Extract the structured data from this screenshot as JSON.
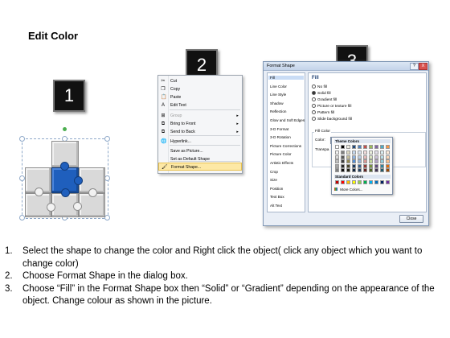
{
  "title": "Edit Color",
  "steps": [
    "1",
    "2",
    "3"
  ],
  "context_menu": {
    "items": [
      {
        "label": "Cut",
        "icon": "cut-icon",
        "glyph": "✂",
        "disabled": false,
        "arrow": ""
      },
      {
        "label": "Copy",
        "icon": "copy-icon",
        "glyph": "❐",
        "disabled": false,
        "arrow": ""
      },
      {
        "label": "Paste",
        "icon": "paste-icon",
        "glyph": "📋",
        "disabled": false,
        "arrow": ""
      },
      {
        "label": "Edit Text",
        "icon": "edit-text-icon",
        "glyph": "A",
        "disabled": false,
        "arrow": ""
      },
      {
        "label": "Group",
        "icon": "group-icon",
        "glyph": "⊞",
        "disabled": true,
        "arrow": "▸"
      },
      {
        "label": "Bring to Front",
        "icon": "bring-front-icon",
        "glyph": "⧉",
        "disabled": false,
        "arrow": "▸"
      },
      {
        "label": "Send to Back",
        "icon": "send-back-icon",
        "glyph": "⧉",
        "disabled": false,
        "arrow": "▸"
      },
      {
        "label": "Hyperlink...",
        "icon": "hyperlink-icon",
        "glyph": "🌐",
        "disabled": false,
        "arrow": ""
      },
      {
        "label": "Save as Picture...",
        "icon": "",
        "glyph": "",
        "disabled": false,
        "arrow": ""
      },
      {
        "label": "Set as Default Shape",
        "icon": "",
        "glyph": "",
        "disabled": false,
        "arrow": ""
      },
      {
        "label": "Size and Position...",
        "icon": "size-position-icon",
        "glyph": "⊡",
        "disabled": false,
        "arrow": ""
      },
      {
        "label": "Format Shape...",
        "icon": "format-shape-icon",
        "glyph": "🖌",
        "disabled": false,
        "arrow": ""
      }
    ]
  },
  "dialog": {
    "title": "Format Shape",
    "help_button": "?",
    "close_x": "X",
    "nav": [
      "Fill",
      "Line Color",
      "Line Style",
      "Shadow",
      "Reflection",
      "Glow and Soft Edges",
      "3-D Format",
      "3-D Rotation",
      "Picture Corrections",
      "Picture Color",
      "Artistic Effects",
      "Crop",
      "Size",
      "Position",
      "Text Box",
      "Alt Text"
    ],
    "pane": {
      "heading": "Fill",
      "options": [
        "No fill",
        "Solid fill",
        "Gradient fill",
        "Picture or texture fill",
        "Pattern fill",
        "Slide background fill"
      ],
      "selected_option": 1,
      "fill_color_group": "Fill Color",
      "color_label": "Color:",
      "transparency_label": "Transpa"
    },
    "close_button": "Close"
  },
  "color_popup": {
    "theme_label": "Theme Colors",
    "standard_label": "Standard Colors",
    "more_label": "More Colors...",
    "theme_top": [
      "#ffffff",
      "#000000",
      "#eeece1",
      "#1f497d",
      "#4f81bd",
      "#c0504d",
      "#9bbb59",
      "#8064a2",
      "#4bacc6",
      "#f79646"
    ],
    "theme_shades": [
      [
        "#f2f2f2",
        "#7f7f7f",
        "#ddd9c3",
        "#c6d9f0",
        "#dbe5f1",
        "#f2dcdb",
        "#ebf1dd",
        "#e5e0ec",
        "#dbeef3",
        "#fdeada"
      ],
      [
        "#d8d8d8",
        "#595959",
        "#c4bd97",
        "#8db3e2",
        "#b8cce4",
        "#e5b9b7",
        "#d7e3bc",
        "#ccc1d9",
        "#b7dde8",
        "#fbd5b5"
      ],
      [
        "#bfbfbf",
        "#3f3f3f",
        "#938953",
        "#548dd4",
        "#95b3d7",
        "#d99694",
        "#c3d69b",
        "#b2a2c7",
        "#92cddc",
        "#fac08f"
      ],
      [
        "#a5a5a5",
        "#262626",
        "#494429",
        "#17365d",
        "#366092",
        "#953734",
        "#76923c",
        "#5f497a",
        "#31859b",
        "#e36c09"
      ],
      [
        "#7f7f7f",
        "#0c0c0c",
        "#1d1b10",
        "#0f243e",
        "#244061",
        "#632423",
        "#4f6128",
        "#3f3151",
        "#205867",
        "#974806"
      ]
    ],
    "standard": [
      "#c00000",
      "#ff0000",
      "#ffc000",
      "#ffff00",
      "#92d050",
      "#00b050",
      "#00b0f0",
      "#0070c0",
      "#002060",
      "#7030a0"
    ]
  },
  "instructions": [
    {
      "num": "1.",
      "text": "Select the shape to change the color and Right click the object( click any object which you want to change color)"
    },
    {
      "num": "2.",
      "text": "Choose Format Shape in the dialog box."
    },
    {
      "num": "3.",
      "text": "Choose “Fill” in the Format Shape box then “Solid” or “Gradient” depending on the appearance of the object. Change colour as shown in the picture."
    }
  ]
}
